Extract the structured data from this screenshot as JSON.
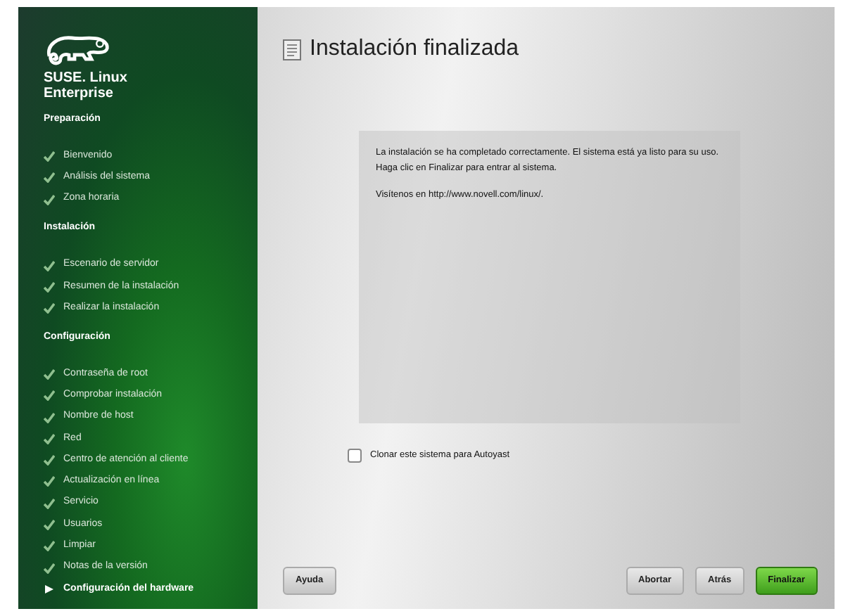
{
  "sidebar": {
    "brand": [
      "SUSE. Linux",
      "Enterprise"
    ],
    "sections": [
      {
        "title": "Preparación",
        "items": [
          {
            "label": "Bienvenido",
            "selected": false
          },
          {
            "label": "Análisis del sistema",
            "selected": false
          },
          {
            "label": "Zona horaria",
            "selected": false
          }
        ]
      },
      {
        "title": "Instalación",
        "items": [
          {
            "label": "Escenario de servidor",
            "selected": false
          },
          {
            "label": "Resumen de la instalación",
            "selected": false
          },
          {
            "label": "Realizar la instalación",
            "selected": false
          }
        ]
      },
      {
        "title": "Configuración",
        "items": [
          {
            "label": "Contraseña de root",
            "selected": false
          },
          {
            "label": "Comprobar instalación",
            "selected": false
          },
          {
            "label": "Nombre de host",
            "selected": false
          },
          {
            "label": "Red",
            "selected": false
          },
          {
            "label": "Centro de atención al cliente",
            "selected": false
          },
          {
            "label": "Actualización en línea",
            "selected": false
          },
          {
            "label": "Servicio",
            "selected": false
          },
          {
            "label": "Usuarios",
            "selected": false
          },
          {
            "label": "Limpiar",
            "selected": false
          },
          {
            "label": "Notas de la versión",
            "selected": false
          },
          {
            "label": "Configuración del hardware",
            "selected": true
          }
        ]
      }
    ]
  },
  "title": "Instalación finalizada",
  "message": [
    "La instalación se ha completado correctamente. El sistema está ya listo para su uso. Haga clic en Finalizar para entrar al sistema.",
    "Visítenos en http://www.novell.com/linux/."
  ],
  "clone_checkbox": {
    "label": "Clonar este sistema para Autoyast",
    "checked": false
  },
  "buttons": [
    {
      "label": "Ayuda",
      "kind": "help"
    },
    {
      "label": "Abortar",
      "kind": "normal"
    },
    {
      "label": "Atrás",
      "kind": "normal"
    },
    {
      "label": "Finalizar",
      "kind": "primary"
    }
  ]
}
